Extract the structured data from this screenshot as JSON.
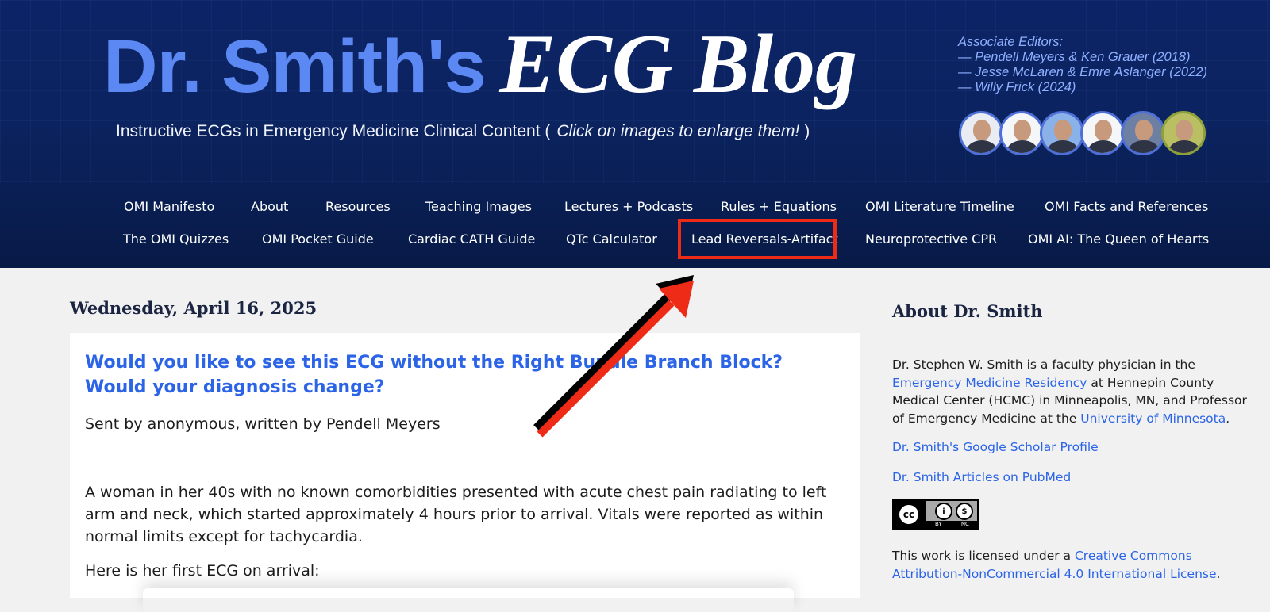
{
  "header": {
    "title_sans": "Dr. Smith's",
    "title_serif": "ECG Blog",
    "tagline_prefix": "Instructive ECGs in Emergency Medicine Clinical Content (",
    "tagline_note": "Click on images to enlarge them!",
    "tagline_suffix": ")",
    "editors": [
      "Associate Editors:",
      "— Pendell Meyers & Ken Grauer (2018)",
      "— Jesse McLaren & Emre Aslanger (2022)",
      "— Willy Frick (2024)"
    ]
  },
  "nav": {
    "row1": [
      "OMI Manifesto",
      "About",
      "Resources",
      "Teaching Images",
      "Lectures + Podcasts",
      "Rules + Equations",
      "OMI Literature Timeline",
      "OMI Facts and References"
    ],
    "row2": [
      "The OMI Quizzes",
      "OMI Pocket Guide",
      "Cardiac CATH Guide",
      "QTc Calculator",
      "Lead Reversals-Artifact",
      "Neuroprotective CPR",
      "OMI AI: The Queen of Hearts"
    ],
    "highlighted": "Lead Reversals-Artifact"
  },
  "post": {
    "date": "Wednesday, April 16, 2025",
    "title": "Would you like to see this ECG without the Right Bundle Branch Block? Would your diagnosis change?",
    "byline": "Sent by anonymous, written by Pendell Meyers",
    "paragraph1": "A woman in her 40s with no known comorbidities presented with acute chest pain radiating to left arm and neck, which started approximately 4 hours prior to arrival. Vitals were reported as within normal limits except for tachycardia.",
    "paragraph2": "Here is her first ECG on arrival:"
  },
  "sidebar": {
    "heading": "About Dr. Smith",
    "bio_1": "Dr. Stephen W. Smith is a faculty physician in the ",
    "bio_link_1": "Emergency Medicine Residency",
    "bio_2": " at Hennepin County Medical Center (HCMC) in Minneapolis, MN, and Professor of Emergency Medicine at the ",
    "bio_link_2": "University of Minnesota",
    "bio_3": ".",
    "scholar_link": "Dr. Smith's Google Scholar Profile",
    "pubmed_link": "Dr. Smith Articles on PubMed",
    "cc_badge": {
      "cc": "cc",
      "by": "BY",
      "nc": "NC"
    },
    "license_prefix": "This work is licensed under a ",
    "license_link": "Creative Commons Attribution-NonCommercial 4.0 International License",
    "license_suffix": "."
  },
  "colors": {
    "header_bg": "#0b235f",
    "title_blue": "#5b88f2",
    "link_blue": "#2b64e7",
    "highlight_red": "#ee2b17"
  },
  "icons": [
    "creative-commons-icon",
    "attribution-icon",
    "noncommercial-icon",
    "annotation-arrow"
  ]
}
